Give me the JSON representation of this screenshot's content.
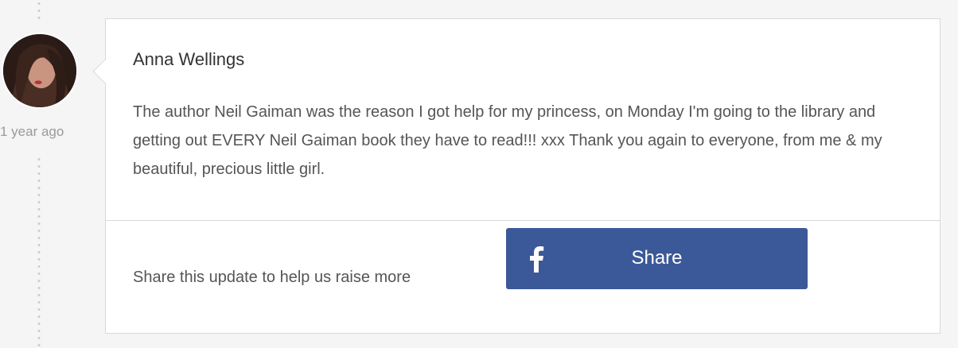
{
  "update": {
    "author_name": "Anna Wellings",
    "time_ago": "1 year ago",
    "message": "The author Neil Gaiman was the reason I got help for my princess, on Monday I'm going to the library and getting out EVERY Neil Gaiman book they have to read!!! xxx Thank you again to everyone, from me & my beautiful, precious little girl."
  },
  "share": {
    "prompt": "Share this update to help us raise more",
    "button_label": "Share",
    "button_icon": "facebook-icon",
    "button_color": "#3b5998"
  }
}
